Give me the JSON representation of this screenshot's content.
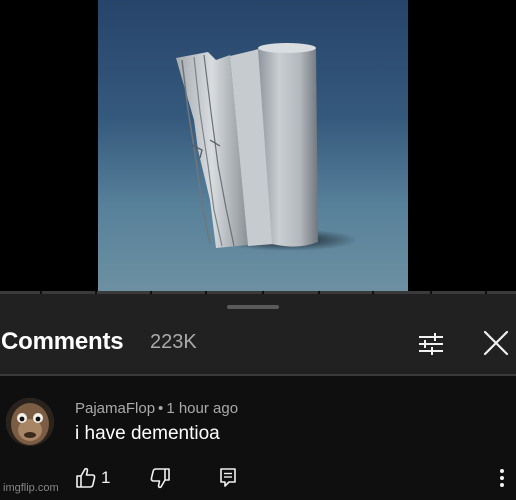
{
  "comments_panel": {
    "title": "Comments",
    "count": "223K"
  },
  "icons": {
    "filter": "sliders-icon",
    "close": "close-icon",
    "like": "thumbs-up-icon",
    "dislike": "thumbs-down-icon",
    "reply": "reply-icon",
    "more": "more-vertical-icon"
  },
  "comment": {
    "author": "PajamaFlop",
    "separator": "•",
    "time": "1 hour ago",
    "text": "i have dementioa",
    "likes": "1"
  },
  "watermark": "imgflip.com"
}
